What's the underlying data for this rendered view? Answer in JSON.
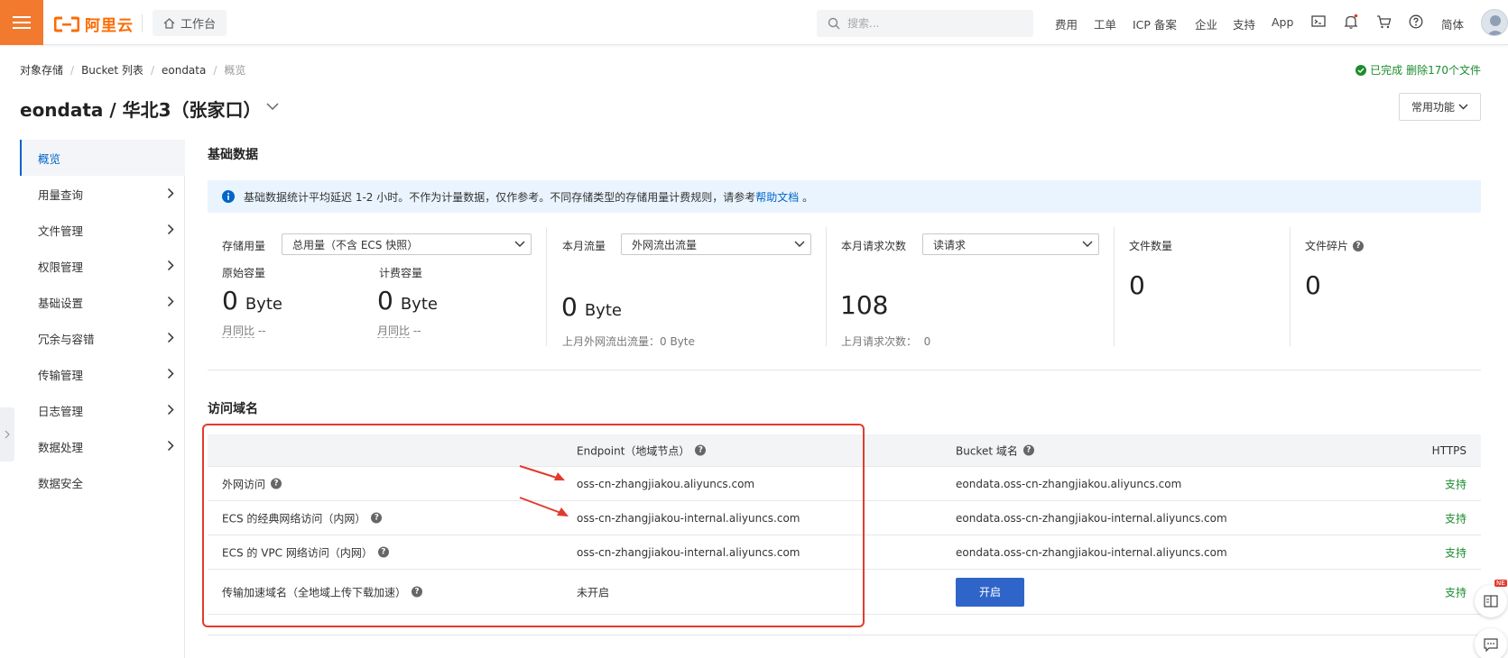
{
  "topbar": {
    "logo_text": "阿里云",
    "workbench_label": "工作台",
    "search_placeholder": "搜索...",
    "nav_links": [
      "费用",
      "工单",
      "ICP 备案",
      "企业",
      "支持",
      "App"
    ],
    "lang_label": "简体",
    "accent_color": "#ff6a00"
  },
  "breadcrumb": {
    "items": [
      "对象存储",
      "Bucket 列表",
      "eondata"
    ],
    "current": "概览"
  },
  "status": {
    "done_label": "已完成",
    "action_text": "删除170个文件"
  },
  "header": {
    "title": "eondata / 华北3（张家口）",
    "common_functions": "常用功能"
  },
  "sidebar": {
    "items": [
      {
        "label": "概览",
        "active": true
      },
      {
        "label": "用量查询"
      },
      {
        "label": "文件管理"
      },
      {
        "label": "权限管理"
      },
      {
        "label": "基础设置"
      },
      {
        "label": "冗余与容错"
      },
      {
        "label": "传输管理"
      },
      {
        "label": "日志管理"
      },
      {
        "label": "数据处理"
      },
      {
        "label": "数据安全"
      }
    ]
  },
  "basic": {
    "section_title": "基础数据",
    "info_text": "基础数据统计平均延迟 1-2 小时。不作为计量数据，仅作参考。不同存储类型的存储用量计费规则，请参考",
    "info_link": "帮助文档",
    "info_suffix": "。",
    "storage": {
      "label": "存储用量",
      "select": "总用量（不含 ECS 快照）",
      "raw_label": "原始容量",
      "raw_value": "0",
      "raw_unit": "Byte",
      "billed_label": "计费容量",
      "billed_value": "0",
      "billed_unit": "Byte",
      "mom_label": "月同比",
      "mom_value": "--"
    },
    "traffic": {
      "label": "本月流量",
      "select": "外网流出流量",
      "value": "0",
      "unit": "Byte",
      "last_label": "上月外网流出流量：",
      "last_value": "0 Byte"
    },
    "requests": {
      "label": "本月请求次数",
      "select": "读请求",
      "value": "108",
      "last_label": "上月请求次数：",
      "last_value": "0"
    },
    "files": {
      "label": "文件数量",
      "value": "0"
    },
    "fragments": {
      "label": "文件碎片",
      "value": "0"
    }
  },
  "domains": {
    "section_title": "访问域名",
    "headers": {
      "endpoint": "Endpoint（地域节点）",
      "bucket": "Bucket 域名",
      "https": "HTTPS"
    },
    "rows": [
      {
        "name": "外网访问",
        "endpoint": "oss-cn-zhangjiakou.aliyuncs.com",
        "bucket": "eondata.oss-cn-zhangjiakou.aliyuncs.com",
        "https": "支持"
      },
      {
        "name": "ECS 的经典网络访问（内网）",
        "endpoint": "oss-cn-zhangjiakou-internal.aliyuncs.com",
        "bucket": "eondata.oss-cn-zhangjiakou-internal.aliyuncs.com",
        "https": "支持"
      },
      {
        "name": "ECS 的 VPC 网络访问（内网）",
        "endpoint": "oss-cn-zhangjiakou-internal.aliyuncs.com",
        "bucket": "eondata.oss-cn-zhangjiakou-internal.aliyuncs.com",
        "https": "支持"
      },
      {
        "name": "传输加速域名（全地域上传下载加速）",
        "endpoint": "未开启",
        "bucket_button": "开启",
        "https": "支持"
      }
    ]
  },
  "floating": {
    "new_badge": "NE"
  }
}
